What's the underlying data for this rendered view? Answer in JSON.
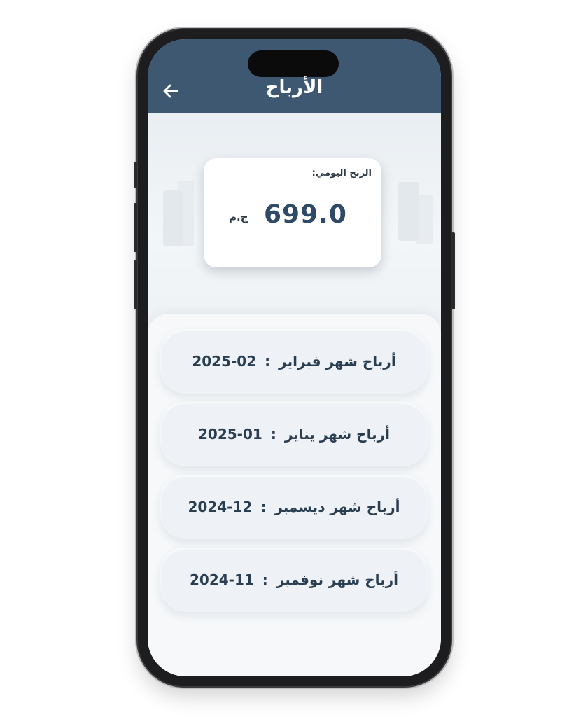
{
  "header": {
    "title": "الأرباح",
    "back_icon": "arrow-left-icon"
  },
  "daily_profit": {
    "label": "الربح اليومي:",
    "amount": "699.0",
    "currency": "ج.م"
  },
  "monthly_profits": [
    {
      "label": "أرباح شهر فبراير",
      "separator": ":",
      "date": "2025-02"
    },
    {
      "label": "أرباح شهر يناير",
      "separator": ":",
      "date": "2025-01"
    },
    {
      "label": "أرباح شهر ديسمبر",
      "separator": ":",
      "date": "2024-12"
    },
    {
      "label": "أرباح شهر نوفمبر",
      "separator": ":",
      "date": "2024-11"
    }
  ],
  "colors": {
    "header": "#3e5871",
    "accent_text": "#2f4a66",
    "background": "#f2f5f8"
  }
}
